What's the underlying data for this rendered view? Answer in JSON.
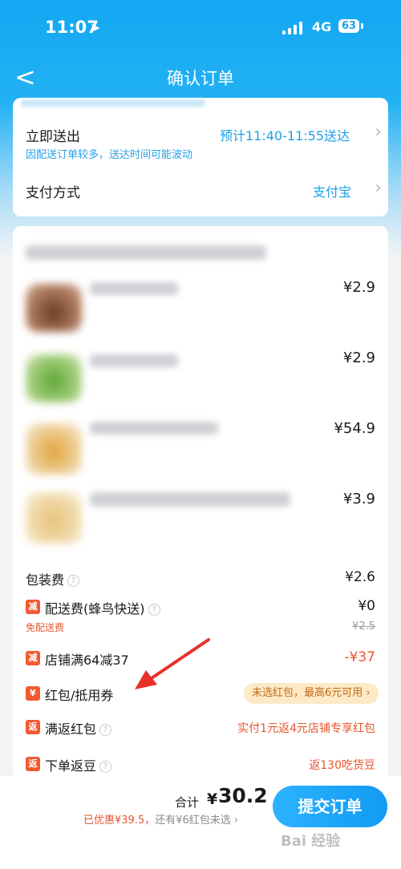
{
  "status_bar": {
    "time": "11:07",
    "network": "4G",
    "battery": "63"
  },
  "nav": {
    "back_symbol": "<",
    "title": "确认订单"
  },
  "delivery": {
    "label": "立即送出",
    "eta": "预计11:40-11:55送达",
    "note": "因配送订单较多，送达时间可能波动",
    "payment_label": "支付方式",
    "payment_value": "支付宝"
  },
  "items": [
    {
      "price": "¥2.9"
    },
    {
      "price": "¥2.9"
    },
    {
      "price": "¥54.9"
    },
    {
      "price": "¥3.9"
    }
  ],
  "fees": {
    "packing_label": "包装费",
    "packing_value": "¥2.6",
    "delivery_tag": "减",
    "delivery_label": "配送费(蜂鸟快送)",
    "delivery_value": "¥0",
    "free_delivery": "免配送费",
    "delivery_original": "¥2.5",
    "shop_tag": "减",
    "shop_discount_label": "店铺满64减37",
    "shop_discount_value": "-¥37",
    "coupon_tag": "¥",
    "coupon_label": "红包/抵用券",
    "coupon_status": "未选红包，最高6元可用",
    "cashback_tag": "返",
    "cashback_label": "满返红包",
    "cashback_value": "实付1元返4元店铺专享红包",
    "beans_tag": "返",
    "beans_label": "下单返豆",
    "beans_value": "返130吃货豆"
  },
  "footer": {
    "total_label": "合计",
    "currency": "¥",
    "total_value": "30.2",
    "discount_text": "已优惠¥39.5，",
    "unselected_text": "还有¥6红包未选",
    "submit_label": "提交订单"
  },
  "watermark": "Bai 经验",
  "colors": {
    "accent_blue": "#1e9fe8",
    "discount_red": "#e9542e",
    "annotation_arrow": "#e8302a"
  },
  "icons": [
    "back-chevron-icon",
    "location-arrow-icon",
    "signal-icon",
    "battery-icon",
    "chevron-right-icon",
    "help-circle-icon",
    "annotation-arrow-icon"
  ]
}
